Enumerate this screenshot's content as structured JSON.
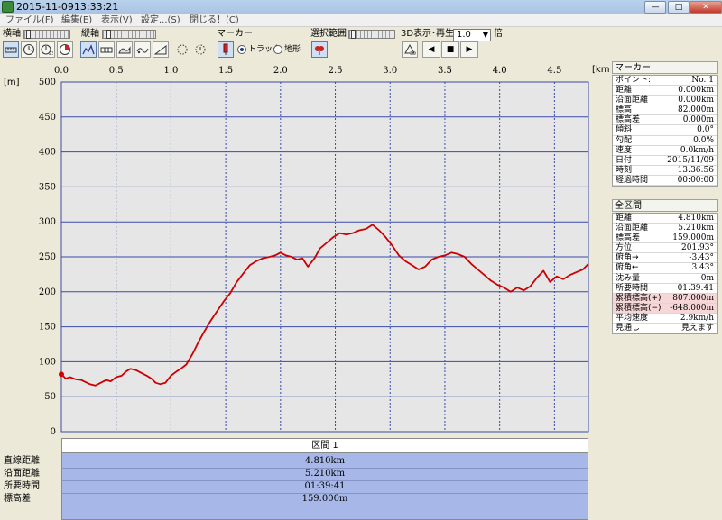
{
  "window": {
    "title": "2015-11-0913:33:21",
    "btn_min": "—",
    "btn_max": "□",
    "btn_close": "✕"
  },
  "menu": {
    "items": [
      "ファイル(F)",
      "編集(E)",
      "表示(V)",
      "設定...(S)",
      "閉じる！(C)"
    ]
  },
  "toolbar": {
    "horizontal_label": "横軸",
    "vertical_label": "縦軸",
    "marker_label": "マーカー",
    "marker_options": [
      "トラック",
      "地形"
    ],
    "selection_label": "選択範囲",
    "playback_label": "3D表示･再生",
    "speed_value": "1.0",
    "speed_unit": "倍",
    "speed_arrow": "▼",
    "play_prev": "◀",
    "play_stop": "■",
    "play_next": "▶"
  },
  "chart_data": {
    "type": "line",
    "xlabel": "[km]",
    "ylabel": "[m]",
    "xlim": [
      0,
      4.81
    ],
    "ylim": [
      0,
      500
    ],
    "x_ticks": [
      "0.0",
      "0.5",
      "1.0",
      "1.5",
      "2.0",
      "2.5",
      "3.0",
      "3.5",
      "4.0",
      "4.5"
    ],
    "y_ticks": [
      "0",
      "50",
      "100",
      "150",
      "200",
      "250",
      "300",
      "350",
      "400",
      "450",
      "500"
    ],
    "grid": true,
    "color": "#cc0000",
    "x": [
      0.0,
      0.04,
      0.08,
      0.13,
      0.18,
      0.22,
      0.26,
      0.31,
      0.36,
      0.41,
      0.45,
      0.5,
      0.55,
      0.59,
      0.63,
      0.68,
      0.73,
      0.78,
      0.82,
      0.86,
      0.9,
      0.95,
      1.0,
      1.05,
      1.09,
      1.14,
      1.2,
      1.25,
      1.3,
      1.36,
      1.42,
      1.48,
      1.54,
      1.6,
      1.66,
      1.72,
      1.78,
      1.84,
      1.9,
      1.95,
      2.0,
      2.05,
      2.1,
      2.15,
      2.2,
      2.25,
      2.31,
      2.36,
      2.42,
      2.48,
      2.54,
      2.6,
      2.66,
      2.72,
      2.78,
      2.84,
      2.9,
      2.96,
      3.02,
      3.08,
      3.14,
      3.2,
      3.26,
      3.32,
      3.38,
      3.44,
      3.5,
      3.56,
      3.62,
      3.68,
      3.74,
      3.8,
      3.86,
      3.92,
      3.98,
      4.04,
      4.1,
      4.16,
      4.22,
      4.28,
      4.34,
      4.4,
      4.46,
      4.52,
      4.58,
      4.64,
      4.7,
      4.76,
      4.81
    ],
    "y": [
      82,
      76,
      78,
      75,
      74,
      71,
      68,
      66,
      70,
      74,
      72,
      78,
      80,
      86,
      90,
      88,
      84,
      80,
      76,
      70,
      68,
      70,
      80,
      86,
      90,
      96,
      112,
      128,
      142,
      158,
      172,
      186,
      198,
      214,
      226,
      238,
      244,
      248,
      250,
      252,
      256,
      252,
      250,
      246,
      248,
      236,
      248,
      262,
      270,
      278,
      284,
      282,
      284,
      288,
      290,
      296,
      288,
      278,
      266,
      252,
      244,
      238,
      232,
      236,
      246,
      250,
      252,
      256,
      254,
      250,
      240,
      232,
      224,
      216,
      210,
      206,
      200,
      206,
      202,
      208,
      220,
      230,
      214,
      222,
      218,
      224,
      228,
      232,
      240
    ]
  },
  "section": {
    "header": "区間 1",
    "labels": [
      "直線距離",
      "沿面距離",
      "所要時間",
      "標高差"
    ],
    "values": [
      "4.810km",
      "5.210km",
      "01:39:41",
      "159.000m"
    ]
  },
  "marker_panel": {
    "title": "マーカー",
    "rows": [
      {
        "k": "ポイント:",
        "v": "No. 1"
      },
      {
        "k": "距離",
        "v": "0.000km"
      },
      {
        "k": "沿面距離",
        "v": "0.000km"
      },
      {
        "k": "標高",
        "v": "82.000m"
      },
      {
        "k": "標高差",
        "v": "0.000m"
      },
      {
        "k": "傾斜",
        "v": "0.0°"
      },
      {
        "k": "勾配",
        "v": "0.0%"
      },
      {
        "k": "速度",
        "v": "0.0km/h"
      },
      {
        "k": "日付",
        "v": "2015/11/09"
      },
      {
        "k": "時刻",
        "v": "13:36:56"
      },
      {
        "k": "経過時間",
        "v": "00:00:00"
      }
    ]
  },
  "total_panel": {
    "title": "全区間",
    "rows": [
      {
        "k": "距離",
        "v": "4.810km"
      },
      {
        "k": "沿面距離",
        "v": "5.210km"
      },
      {
        "k": "標高差",
        "v": "159.000m"
      },
      {
        "k": "方位",
        "v": "201.93°"
      },
      {
        "k": "俯角→",
        "v": "-3.43°"
      },
      {
        "k": "俯角←",
        "v": "3.43°"
      },
      {
        "k": "沈み量",
        "v": "-0m"
      },
      {
        "k": "所要時間",
        "v": "01:39:41"
      },
      {
        "k": "累積標高(+)",
        "v": "807.000m",
        "pink": true
      },
      {
        "k": "累積標高(−)",
        "v": "-648.000m",
        "pink": true
      },
      {
        "k": "平均速度",
        "v": "2.9km/h"
      },
      {
        "k": "見通し",
        "v": "見えます"
      }
    ]
  }
}
